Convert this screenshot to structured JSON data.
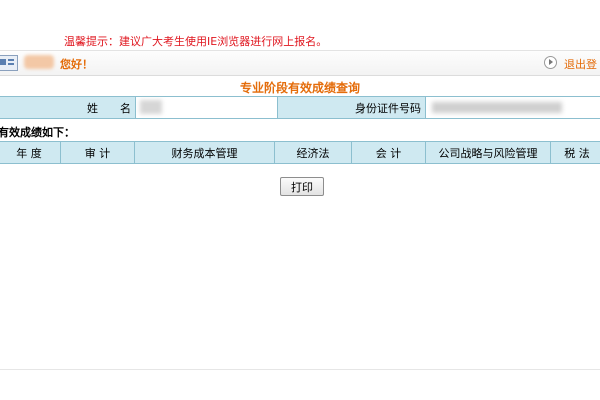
{
  "notice": {
    "text": "温馨提示：建议广大考生使用IE浏览器进行网上报名。"
  },
  "userbar": {
    "greeting": "您好！",
    "logout": "退出登"
  },
  "page": {
    "title": "专业阶段有效成绩查询"
  },
  "info": {
    "name_label": "姓　　名",
    "id_label": "身份证件号码"
  },
  "scores": {
    "section_label": "有效成绩如下：",
    "columns": [
      "年 度",
      "审 计",
      "财务成本管理",
      "经济法",
      "会 计",
      "公司战略与风险管理",
      "税 法"
    ]
  },
  "actions": {
    "print": "打印"
  },
  "colors": {
    "notice_red": "#e0161f",
    "accent_orange": "#e46c0a",
    "header_cell_bg": "#cfe9f1",
    "table_border": "#8cbfcf"
  }
}
